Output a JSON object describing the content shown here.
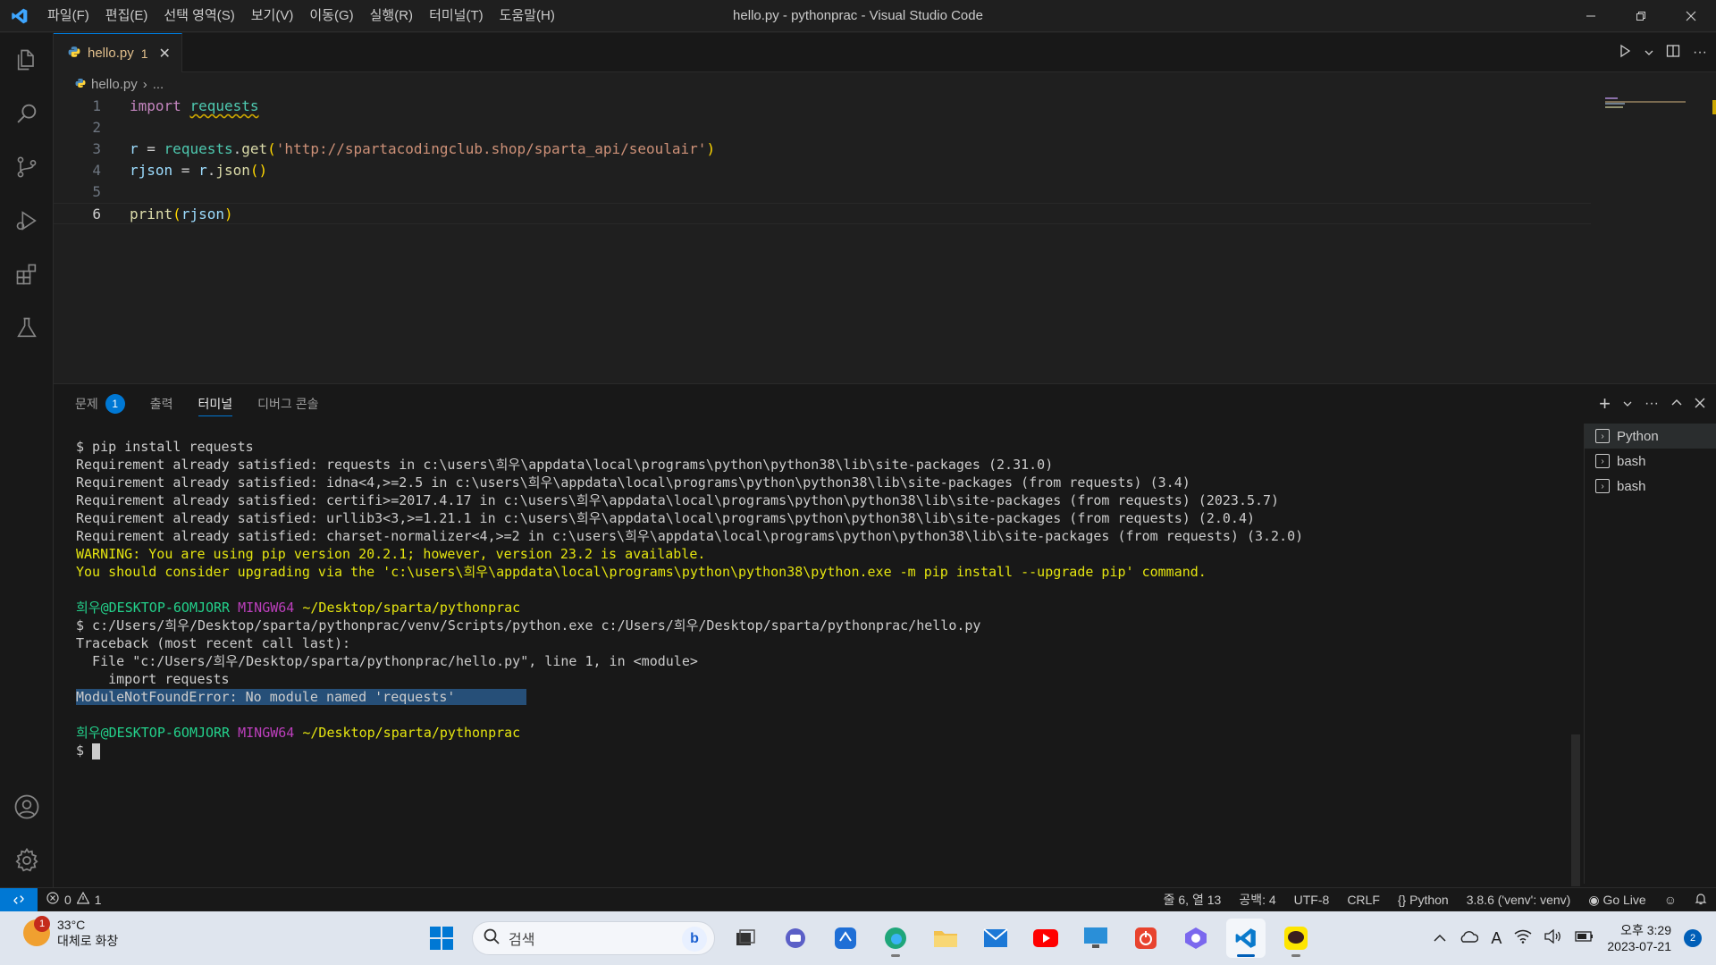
{
  "window": {
    "title": "hello.py - pythonprac - Visual Studio Code",
    "menu": [
      "파일(F)",
      "편집(E)",
      "선택 영역(S)",
      "보기(V)",
      "이동(G)",
      "실행(R)",
      "터미널(T)",
      "도움말(H)"
    ]
  },
  "tab": {
    "label": "hello.py",
    "badge": "1"
  },
  "breadcrumb": {
    "file": "hello.py",
    "rest": "..."
  },
  "code": {
    "line_numbers": [
      "1",
      "2",
      "3",
      "4",
      "5",
      "6"
    ],
    "l1_kw": "import",
    "l1_mod": "requests",
    "l3_var": "r",
    "l3_eq": " = ",
    "l3_obj": "requests",
    "l3_dot": ".",
    "l3_fn": "get",
    "l3_open": "(",
    "l3_str": "'http://spartacodingclub.shop/sparta_api/seoulair'",
    "l3_close": ")",
    "l4_var": "rjson",
    "l4_eq": " = ",
    "l4_obj": "r",
    "l4_dot": ".",
    "l4_fn": "json",
    "l4_parens": "()",
    "l6_fn": "print",
    "l6_open": "(",
    "l6_arg": "rjson",
    "l6_close": ")"
  },
  "panel": {
    "tabs": [
      "문제",
      "출력",
      "터미널",
      "디버그 콘솔"
    ],
    "problems_count": "1",
    "active_tab": "터미널"
  },
  "terminal": {
    "lines": [
      "$ pip install requests",
      "Requirement already satisfied: requests in c:\\users\\희우\\appdata\\local\\programs\\python\\python38\\lib\\site-packages (2.31.0)",
      "Requirement already satisfied: idna<4,>=2.5 in c:\\users\\희우\\appdata\\local\\programs\\python\\python38\\lib\\site-packages (from requests) (3.4)",
      "Requirement already satisfied: certifi>=2017.4.17 in c:\\users\\희우\\appdata\\local\\programs\\python\\python38\\lib\\site-packages (from requests) (2023.5.7)",
      "Requirement already satisfied: urllib3<3,>=1.21.1 in c:\\users\\희우\\appdata\\local\\programs\\python\\python38\\lib\\site-packages (from requests) (2.0.4)",
      "Requirement already satisfied: charset-normalizer<4,>=2 in c:\\users\\희우\\appdata\\local\\programs\\python\\python38\\lib\\site-packages (from requests) (3.2.0)"
    ],
    "warn1": "WARNING: You are using pip version 20.2.1; however, version 23.2 is available.",
    "warn2": "You should consider upgrading via the 'c:\\users\\희우\\appdata\\local\\programs\\python\\python38\\python.exe -m pip install --upgrade pip' command.",
    "prompt_user": "희우@DESKTOP-6OMJORR",
    "prompt_host": "MINGW64",
    "prompt_path": "~/Desktop/sparta/pythonprac",
    "run_cmd": "$ c:/Users/희우/Desktop/sparta/pythonprac/venv/Scripts/python.exe c:/Users/희우/Desktop/sparta/pythonprac/hello.py",
    "tb1": "Traceback (most recent call last):",
    "tb2": "  File \"c:/Users/희우/Desktop/sparta/pythonprac/hello.py\", line 1, in <module>",
    "tb3": "    import requests",
    "error": "ModuleNotFoundError: No module named 'requests'",
    "prompt_symbol": "$ "
  },
  "terminal_list": [
    "Python",
    "bash",
    "bash"
  ],
  "statusbar": {
    "errors": "0",
    "warnings": "1",
    "position": "줄 6, 열 13",
    "spaces": "공백: 4",
    "encoding": "UTF-8",
    "eol": "CRLF",
    "language": "Python",
    "interpreter": "3.8.6 ('venv': venv)",
    "golive": "Go Live"
  },
  "taskbar": {
    "weather_temp": "33°C",
    "weather_desc": "대체로 화창",
    "weather_badge": "1",
    "search_placeholder": "검색",
    "time": "오후 3:29",
    "date": "2023-07-21",
    "notifications": "2"
  },
  "icons": [
    "vscode-logo-icon",
    "explorer-icon",
    "search-icon",
    "source-control-icon",
    "run-debug-icon",
    "extensions-icon",
    "testing-icon",
    "account-icon",
    "settings-gear-icon"
  ],
  "colors": {
    "accent": "#0078d4",
    "modified_tab": "#e2c08d",
    "selection": "#264f78"
  }
}
